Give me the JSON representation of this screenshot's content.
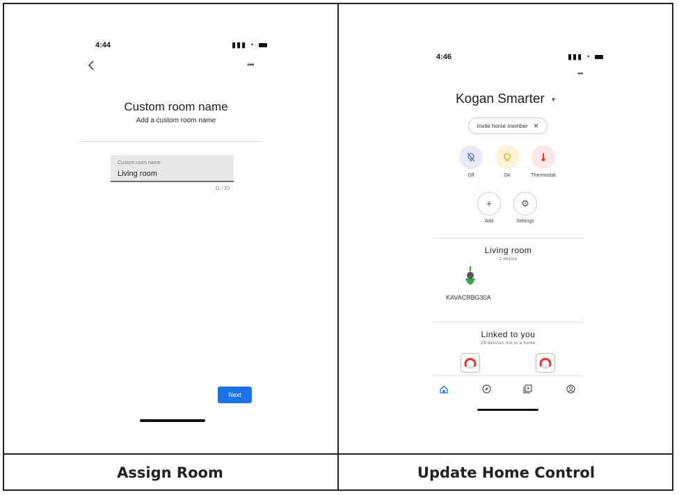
{
  "left_screen": {
    "status_time": "4:44",
    "page_title": "Custom room name",
    "page_subtitle": "Add a custom room name",
    "field": {
      "label": "Custom room name",
      "value": "Living room",
      "counter": "11 / 20"
    },
    "next_label": "Next",
    "caption": "Assign Room"
  },
  "right_screen": {
    "status_time": "4:46",
    "home_name": "Kogan Smarter",
    "invite_chip": "Invite home member",
    "actions": [
      {
        "label": "Off",
        "icon": "light-off-icon",
        "bg": "#e8eaf8",
        "color": "#5c6bc0"
      },
      {
        "label": "On",
        "icon": "lightbulb-icon",
        "bg": "#fdf3d9",
        "color": "#e8a300"
      },
      {
        "label": "Thermostat",
        "icon": "thermometer-icon",
        "bg": "#fde7e7",
        "color": "#e53935"
      }
    ],
    "actions2": [
      {
        "label": "Add",
        "icon": "plus-icon"
      },
      {
        "label": "Settings",
        "icon": "gear-icon"
      }
    ],
    "room": {
      "title": "Living room",
      "subtitle": "1 device",
      "device_name": "KAVACRBG30A"
    },
    "linked": {
      "title": "Linked to you",
      "subtitle": "25 devices not in a home"
    },
    "nav": [
      "home-icon",
      "compass-icon",
      "media-icon",
      "account-icon"
    ],
    "caption": "Update Home Control"
  },
  "colors": {
    "accent": "#1a73e8"
  }
}
